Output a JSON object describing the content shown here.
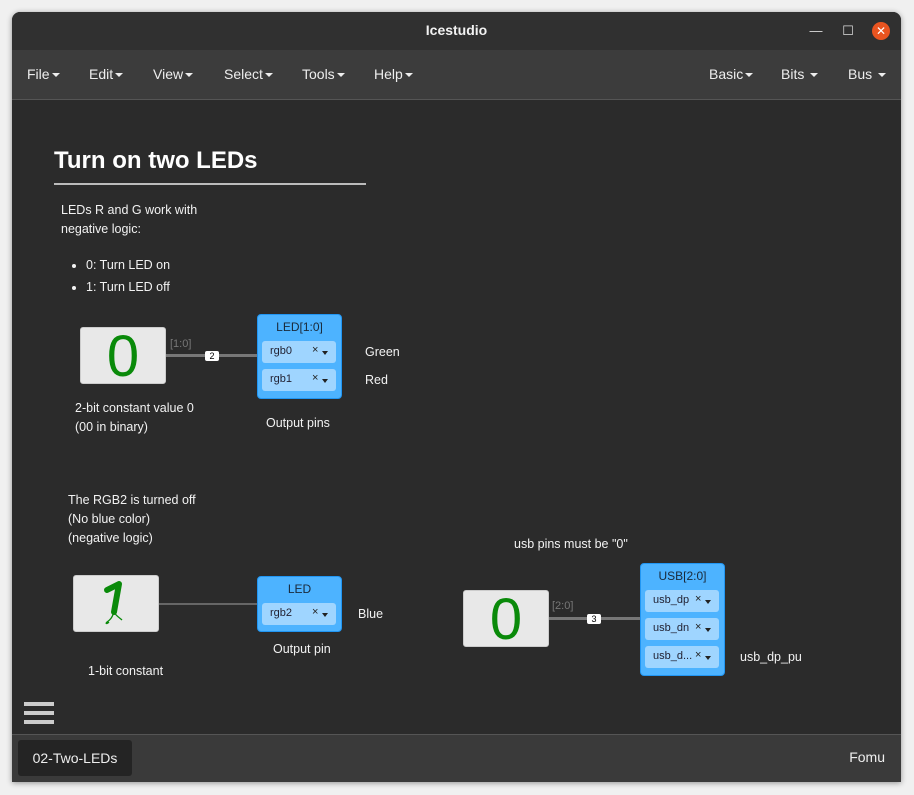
{
  "window": {
    "title": "Icestudio"
  },
  "menubar": {
    "left": [
      {
        "label": "File"
      },
      {
        "label": "Edit"
      },
      {
        "label": "View"
      },
      {
        "label": "Select"
      },
      {
        "label": "Tools"
      },
      {
        "label": "Help"
      }
    ],
    "right": [
      {
        "label": "Basic"
      },
      {
        "label": "Bits"
      },
      {
        "label": "Bus"
      }
    ]
  },
  "canvas": {
    "heading": "Turn on two LEDs",
    "intro": {
      "line1": "LEDs R and G work with",
      "line2": "negative logic:"
    },
    "bullets": [
      "0: Turn LED on",
      "1: Turn LED off"
    ],
    "const1": {
      "value": "0",
      "bus_label": "[1:0]",
      "bus_size": "2",
      "caption1": "2-bit constant value 0",
      "caption2": "(00 in binary)"
    },
    "led_block": {
      "title": "LED[1:0]",
      "pins": [
        {
          "name": "rgb0",
          "x": "×"
        },
        {
          "name": "rgb1",
          "x": "×"
        }
      ],
      "labels": [
        "Green",
        "Red"
      ],
      "caption": "Output pins"
    },
    "rgb2_note": {
      "line1": "The RGB2 is turned off",
      "line2": "(No blue color)",
      "line3": "(negative logic)"
    },
    "const2": {
      "caption": "1-bit constant"
    },
    "led2_block": {
      "title": "LED",
      "pins": [
        {
          "name": "rgb2",
          "x": "×"
        }
      ],
      "labels": [
        "Blue"
      ],
      "caption": "Output pin"
    },
    "usb_note": "usb pins must be \"0\"",
    "const3": {
      "value": "0",
      "bus_label": "[2:0]",
      "bus_size": "3"
    },
    "usb_block": {
      "title": "USB[2:0]",
      "pins": [
        {
          "name": "usb_dp",
          "x": "×"
        },
        {
          "name": "usb_dn",
          "x": "×"
        },
        {
          "name": "usb_d...",
          "x": "×"
        }
      ],
      "labels": [
        "usb_dp_pu"
      ]
    }
  },
  "footer": {
    "tab": "02-Two-LEDs",
    "board": "Fomu"
  },
  "colors": {
    "accent": "#4db3ff",
    "close": "#e95420",
    "const_value": "#0a8a0a"
  }
}
